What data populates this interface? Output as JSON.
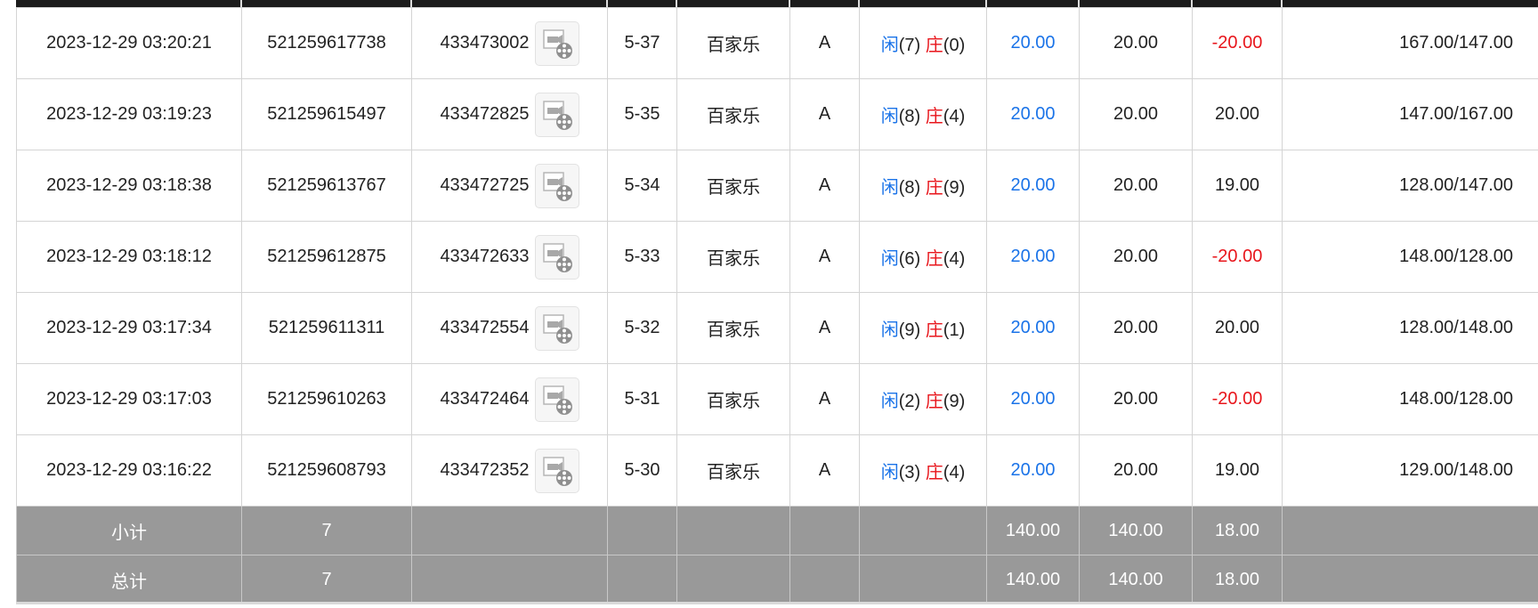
{
  "rows": [
    {
      "time": "2023-12-29 03:20:21",
      "order_id": "521259617738",
      "game_no": "433473002",
      "round": "5-37",
      "game": "百家乐",
      "table": "A",
      "result": {
        "player_label": "闲",
        "player_val": "(7)",
        "banker_label": "庄",
        "banker_val": "(0)"
      },
      "bet": "20.00",
      "valid_bet": "20.00",
      "win": "-20.00",
      "win_color": "red",
      "balance": "167.00/147.00"
    },
    {
      "time": "2023-12-29 03:19:23",
      "order_id": "521259615497",
      "game_no": "433472825",
      "round": "5-35",
      "game": "百家乐",
      "table": "A",
      "result": {
        "player_label": "闲",
        "player_val": "(8)",
        "banker_label": "庄",
        "banker_val": "(4)"
      },
      "bet": "20.00",
      "valid_bet": "20.00",
      "win": "20.00",
      "win_color": "black",
      "balance": "147.00/167.00"
    },
    {
      "time": "2023-12-29 03:18:38",
      "order_id": "521259613767",
      "game_no": "433472725",
      "round": "5-34",
      "game": "百家乐",
      "table": "A",
      "result": {
        "player_label": "闲",
        "player_val": "(8)",
        "banker_label": "庄",
        "banker_val": "(9)"
      },
      "bet": "20.00",
      "valid_bet": "20.00",
      "win": "19.00",
      "win_color": "black",
      "balance": "128.00/147.00"
    },
    {
      "time": "2023-12-29 03:18:12",
      "order_id": "521259612875",
      "game_no": "433472633",
      "round": "5-33",
      "game": "百家乐",
      "table": "A",
      "result": {
        "player_label": "闲",
        "player_val": "(6)",
        "banker_label": "庄",
        "banker_val": "(4)"
      },
      "bet": "20.00",
      "valid_bet": "20.00",
      "win": "-20.00",
      "win_color": "red",
      "balance": "148.00/128.00"
    },
    {
      "time": "2023-12-29 03:17:34",
      "order_id": "521259611311",
      "game_no": "433472554",
      "round": "5-32",
      "game": "百家乐",
      "table": "A",
      "result": {
        "player_label": "闲",
        "player_val": "(9)",
        "banker_label": "庄",
        "banker_val": "(1)"
      },
      "bet": "20.00",
      "valid_bet": "20.00",
      "win": "20.00",
      "win_color": "black",
      "balance": "128.00/148.00"
    },
    {
      "time": "2023-12-29 03:17:03",
      "order_id": "521259610263",
      "game_no": "433472464",
      "round": "5-31",
      "game": "百家乐",
      "table": "A",
      "result": {
        "player_label": "闲",
        "player_val": "(2)",
        "banker_label": "庄",
        "banker_val": "(9)"
      },
      "bet": "20.00",
      "valid_bet": "20.00",
      "win": "-20.00",
      "win_color": "red",
      "balance": "148.00/128.00"
    },
    {
      "time": "2023-12-29 03:16:22",
      "order_id": "521259608793",
      "game_no": "433472352",
      "round": "5-30",
      "game": "百家乐",
      "table": "A",
      "result": {
        "player_label": "闲",
        "player_val": "(3)",
        "banker_label": "庄",
        "banker_val": "(4)"
      },
      "bet": "20.00",
      "valid_bet": "20.00",
      "win": "19.00",
      "win_color": "black",
      "balance": "129.00/148.00"
    }
  ],
  "subtotal": {
    "label": "小计",
    "count": "7",
    "bet": "140.00",
    "valid_bet": "140.00",
    "win": "18.00"
  },
  "total": {
    "label": "总计",
    "count": "7",
    "bet": "140.00",
    "valid_bet": "140.00",
    "win": "18.00"
  },
  "icons": {
    "replay": "video-replay-icon"
  },
  "colors": {
    "blue": "#1a73e8",
    "red": "#e8161c",
    "summary_bg": "#999999",
    "header_bg": "#1c1c1c"
  }
}
